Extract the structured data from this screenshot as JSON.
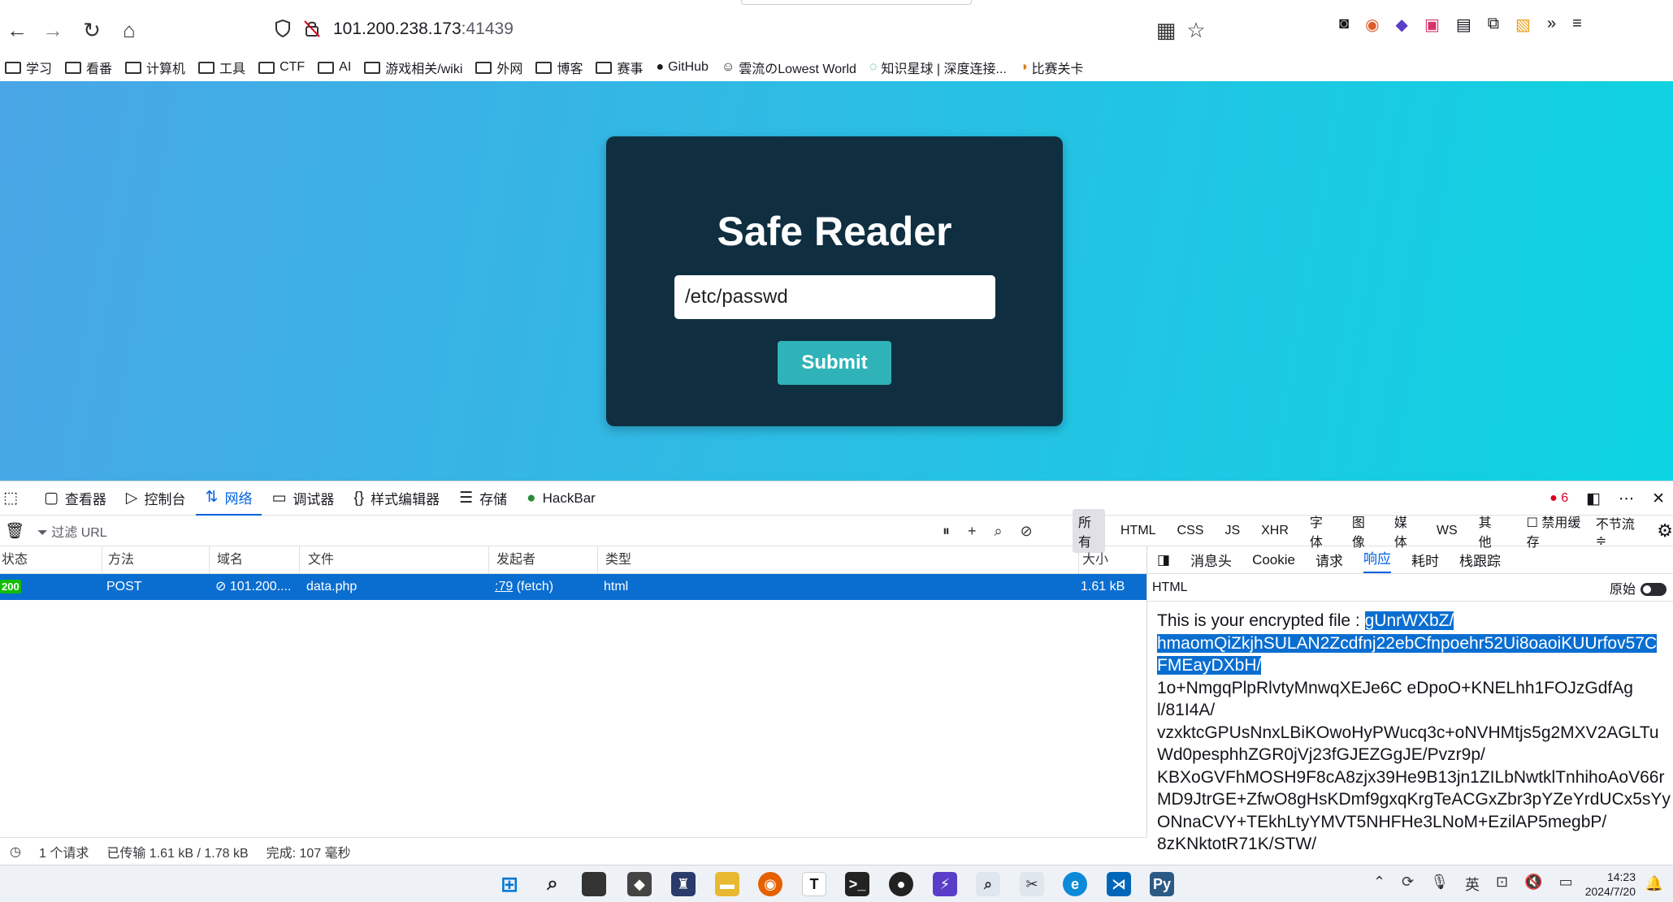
{
  "browser": {
    "url_host": "101.200.238.173",
    "url_port": ":41439",
    "bookmarks": [
      "学习",
      "看番",
      "计算机",
      "工具",
      "CTF",
      "AI",
      "游戏相关/wiki",
      "外网",
      "博客",
      "赛事",
      "GitHub",
      "雲流のLowest World",
      "知识星球 | 深度连接...",
      "比赛关卡"
    ]
  },
  "page": {
    "title": "Safe Reader",
    "input_value": "/etc/passwd",
    "submit_label": "Submit"
  },
  "devtools": {
    "tabs": [
      "查看器",
      "控制台",
      "网络",
      "调试器",
      "样式编辑器",
      "存储",
      "HackBar"
    ],
    "active_tab": "网络",
    "error_count": "6",
    "filter_placeholder": "过滤 URL",
    "filter_types": [
      "所有",
      "HTML",
      "CSS",
      "JS",
      "XHR",
      "字体",
      "图像",
      "媒体",
      "WS",
      "其他"
    ],
    "disable_cache": "禁用缓存",
    "throttle": "不节流 ≑",
    "columns": [
      "状态",
      "方法",
      "域名",
      "文件",
      "发起者",
      "类型",
      "大小"
    ],
    "request": {
      "status": "200",
      "method": "POST",
      "domain": "101.200....",
      "file": "data.php",
      "initiator_link": ":79",
      "initiator_suffix": " (fetch)",
      "type": "html",
      "size": "1.61 kB"
    },
    "status_bar": {
      "requests": "1 个请求",
      "transferred": "已传输 1.61 kB / 1.78 kB",
      "finished": "完成: 107 毫秒"
    },
    "detail_tabs": [
      "消息头",
      "Cookie",
      "请求",
      "响应",
      "耗时",
      "栈跟踪"
    ],
    "detail_active": "响应",
    "html_label": "HTML",
    "raw_label": "原始",
    "response": {
      "prefix": "This is your encrypted file : ",
      "selected_1": "gUnrWXbZ/",
      "selected_2": "hmaomQiZkjhSULAN2Zcdfnj22ebCfnpoehr52Ui8oaoiKUUrfov57C",
      "selected_3": "FMEayDXbH/",
      "lines": [
        "1o+NmgqPlpRlvtyMnwqXEJe6C  eDpoO+KNELhh1FOJzGdfAg",
        "l/81I4A/",
        "vzxktcGPUsNnxLBiKOwoHyPWucq3c+oNVHMtjs5g2MXV2AGLTu",
        "Wd0pesphhZGR0jVj23fGJEZGgJE/Pvzr9p/",
        "KBXoGVFhMOSH9F8cA8zjx39He9B13jn1ZILbNwtklTnhihoAoV66r",
        "MD9JtrGE+ZfwO8gHsKDmf9gxqKrgTeACGxZbr3pYZeYrdUCx5sYy",
        "ONnaCVY+TEkhLtyYMVT5NHFHe3LNoM+EzilAP5megbP/",
        "8zKNktotR71K/STW/"
      ]
    }
  },
  "taskbar": {
    "time": "14:23",
    "date": "2024/7/20",
    "ime": "英"
  },
  "colors": {
    "accent": "#0061e0",
    "selected_row": "#0a6ed1",
    "card_bg": "#0f2f40",
    "submit_bg": "#2fb3b8"
  }
}
